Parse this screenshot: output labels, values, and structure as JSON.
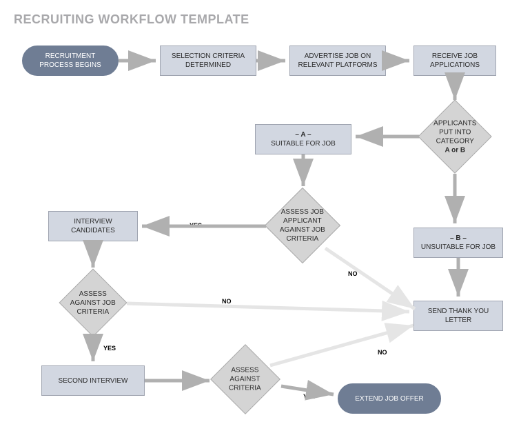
{
  "title": "RECRUITING WORKFLOW TEMPLATE",
  "nodes": {
    "start": {
      "line1": "RECRUITMENT",
      "line2": "PROCESS BEGINS"
    },
    "criteria": {
      "line1": "SELECTION CRITERIA",
      "line2": "DETERMINED"
    },
    "advertise": {
      "line1": "ADVERTISE JOB ON",
      "line2": "RELEVANT PLATFORMS"
    },
    "receive": {
      "line1": "RECEIVE JOB",
      "line2": "APPLICATIONS"
    },
    "categorize": {
      "line1": "APPLICANTS",
      "line2": "PUT INTO",
      "line3": "CATEGORY",
      "line4": "A or B"
    },
    "catA": {
      "header": "– A –",
      "line1": "SUITABLE FOR JOB"
    },
    "catB": {
      "header": "– B –",
      "line1": "UNSUITABLE FOR JOB"
    },
    "assess1": {
      "line1": "ASSESS JOB",
      "line2": "APPLICANT",
      "line3": "AGAINST JOB",
      "line4": "CRITERIA"
    },
    "interview": {
      "line1": "INTERVIEW",
      "line2": "CANDIDATES"
    },
    "assess2": {
      "line1": "ASSESS",
      "line2": "AGAINST JOB",
      "line3": "CRITERIA"
    },
    "second": {
      "line1": "SECOND INTERVIEW"
    },
    "assess3": {
      "line1": "ASSESS",
      "line2": "AGAINST",
      "line3": "CRITERIA"
    },
    "thanks": {
      "line1": "SEND THANK YOU",
      "line2": "LETTER"
    },
    "offer": {
      "line1": "EXTEND JOB OFFER"
    }
  },
  "edge_labels": {
    "assess1_yes": "YES",
    "assess1_no": "NO",
    "assess2_yes": "YES",
    "assess2_no": "NO",
    "assess3_yes": "YES",
    "assess3_no": "NO"
  },
  "colors": {
    "pill_bg": "#6f7d94",
    "rect_bg": "#d2d7e1",
    "diamond_bg": "#d4d4d4",
    "arrow": "#b0b0b0",
    "arrow_light": "#e5e5e5",
    "title": "#a8a8ab"
  }
}
